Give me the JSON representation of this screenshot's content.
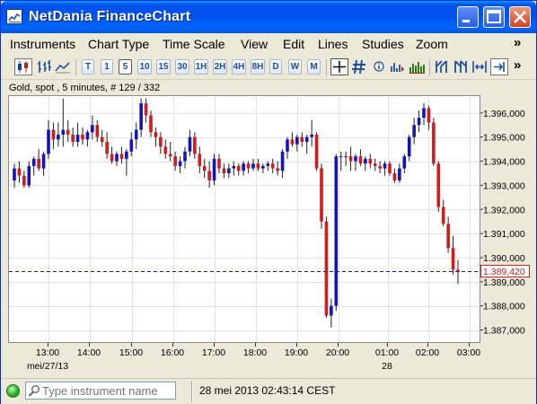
{
  "window": {
    "title": "NetDania FinanceChart"
  },
  "menu": {
    "items": [
      "Instruments",
      "Chart Type",
      "Time Scale",
      "View",
      "Edit",
      "Lines",
      "Studies",
      "Zoom"
    ],
    "more": "»"
  },
  "toolbar": {
    "period_buttons": [
      "T",
      "1",
      "5",
      "10",
      "15",
      "30",
      "1H",
      "2H",
      "4H",
      "8H",
      "D",
      "W",
      "M"
    ],
    "selected_period": "5",
    "more": "»"
  },
  "chart_header": "Gold, spot , 5 minutes, # 129 / 332",
  "statusbar": {
    "search_placeholder": "Type instrument name",
    "datetime": "28 mei 2013 02:43:14 CEST"
  },
  "colors": {
    "up": "#1414b8",
    "down": "#d21c1c",
    "current_line": "#1a237e",
    "titlebar": "#0053ee"
  },
  "chart_data": {
    "type": "candlestick",
    "instrument": "Gold, spot",
    "interval": "5 minutes",
    "ylim": [
      1386.5,
      1396.7
    ],
    "y_ticks": [
      "1.396,000",
      "1.395,000",
      "1.394,000",
      "1.393,000",
      "1.392,000",
      "1.391,000",
      "1.390,000",
      "1.389,000",
      "1.388,000",
      "1.387,000"
    ],
    "y_tick_values": [
      1396,
      1395,
      1394,
      1393,
      1392,
      1391,
      1390,
      1389,
      1388,
      1387
    ],
    "x_ticks": [
      "13:00",
      "14:00",
      "15:00",
      "16:00",
      "17:00",
      "18:00",
      "19:00",
      "20:00",
      "01:00",
      "02:00",
      "03:00"
    ],
    "x_date_labels": [
      {
        "text": "mei/27/13",
        "under": "13:00"
      },
      {
        "text": "28",
        "under": "01:00"
      }
    ],
    "current_price": 1389.42,
    "current_price_label": "1.389,420",
    "candles": [
      [
        1393.2,
        1393.9,
        1392.9,
        1393.7
      ],
      [
        1393.7,
        1394.0,
        1393.1,
        1393.4
      ],
      [
        1393.4,
        1393.6,
        1392.9,
        1393.0
      ],
      [
        1393.0,
        1394.0,
        1392.9,
        1393.8
      ],
      [
        1393.8,
        1394.2,
        1393.4,
        1394.1
      ],
      [
        1394.1,
        1394.5,
        1393.6,
        1393.7
      ],
      [
        1393.7,
        1394.4,
        1393.4,
        1394.3
      ],
      [
        1394.3,
        1395.7,
        1394.1,
        1395.3
      ],
      [
        1395.3,
        1395.6,
        1394.5,
        1394.9
      ],
      [
        1394.9,
        1395.6,
        1394.6,
        1395.1
      ],
      [
        1395.1,
        1396.6,
        1394.6,
        1395.3
      ],
      [
        1395.3,
        1395.7,
        1394.8,
        1395.1
      ],
      [
        1395.1,
        1395.4,
        1394.6,
        1394.8
      ],
      [
        1394.8,
        1395.6,
        1394.6,
        1395.1
      ],
      [
        1395.1,
        1395.4,
        1394.7,
        1394.9
      ],
      [
        1394.9,
        1395.3,
        1394.6,
        1395.2
      ],
      [
        1395.2,
        1395.9,
        1394.9,
        1395.5
      ],
      [
        1395.5,
        1395.7,
        1394.8,
        1395.0
      ],
      [
        1395.0,
        1395.3,
        1394.6,
        1394.8
      ],
      [
        1394.8,
        1395.2,
        1394.1,
        1394.3
      ],
      [
        1394.3,
        1394.6,
        1393.9,
        1394.0
      ],
      [
        1394.0,
        1394.4,
        1393.8,
        1394.3
      ],
      [
        1394.3,
        1394.6,
        1393.9,
        1394.1
      ],
      [
        1394.1,
        1394.5,
        1393.4,
        1394.4
      ],
      [
        1394.4,
        1395.2,
        1394.2,
        1394.9
      ],
      [
        1394.9,
        1395.6,
        1394.5,
        1395.3
      ],
      [
        1395.3,
        1396.6,
        1395.0,
        1396.4
      ],
      [
        1396.4,
        1396.6,
        1395.6,
        1395.9
      ],
      [
        1395.9,
        1396.1,
        1395.0,
        1395.2
      ],
      [
        1395.2,
        1395.4,
        1394.6,
        1395.0
      ],
      [
        1395.0,
        1395.2,
        1394.3,
        1394.6
      ],
      [
        1394.6,
        1394.9,
        1394.1,
        1394.3
      ],
      [
        1394.3,
        1394.8,
        1394.0,
        1394.2
      ],
      [
        1394.2,
        1394.4,
        1393.6,
        1393.8
      ],
      [
        1393.8,
        1394.2,
        1393.5,
        1394.0
      ],
      [
        1394.0,
        1394.6,
        1393.7,
        1394.4
      ],
      [
        1394.4,
        1395.3,
        1394.2,
        1395.0
      ],
      [
        1395.0,
        1395.2,
        1394.1,
        1394.3
      ],
      [
        1394.3,
        1394.6,
        1393.5,
        1393.8
      ],
      [
        1393.8,
        1394.1,
        1393.3,
        1393.6
      ],
      [
        1393.6,
        1394.0,
        1392.9,
        1393.2
      ],
      [
        1393.2,
        1394.3,
        1393.0,
        1394.1
      ],
      [
        1394.1,
        1394.3,
        1393.5,
        1393.7
      ],
      [
        1393.7,
        1393.9,
        1393.3,
        1393.5
      ],
      [
        1393.5,
        1393.9,
        1393.3,
        1393.7
      ],
      [
        1393.7,
        1394.0,
        1393.4,
        1393.8
      ],
      [
        1393.8,
        1393.9,
        1393.4,
        1393.6
      ],
      [
        1393.6,
        1394.0,
        1393.4,
        1393.9
      ],
      [
        1393.9,
        1394.0,
        1393.5,
        1393.7
      ],
      [
        1393.7,
        1394.1,
        1393.6,
        1393.9
      ],
      [
        1393.9,
        1394.1,
        1393.6,
        1393.7
      ],
      [
        1393.7,
        1393.9,
        1393.5,
        1393.8
      ],
      [
        1393.8,
        1394.0,
        1393.6,
        1393.9
      ],
      [
        1393.9,
        1394.1,
        1393.5,
        1393.7
      ],
      [
        1393.7,
        1394.0,
        1393.4,
        1393.6
      ],
      [
        1393.6,
        1394.5,
        1393.3,
        1394.4
      ],
      [
        1394.4,
        1395.0,
        1394.1,
        1394.9
      ],
      [
        1394.9,
        1395.2,
        1394.6,
        1394.7
      ],
      [
        1394.7,
        1395.1,
        1394.4,
        1395.0
      ],
      [
        1395.0,
        1395.2,
        1394.6,
        1394.8
      ],
      [
        1394.8,
        1395.1,
        1394.3,
        1395.0
      ],
      [
        1395.0,
        1395.7,
        1394.6,
        1395.1
      ],
      [
        1395.1,
        1395.2,
        1393.6,
        1393.7
      ],
      [
        1393.7,
        1393.9,
        1391.2,
        1391.5
      ],
      [
        1391.5,
        1391.7,
        1387.5,
        1387.6
      ],
      [
        1387.6,
        1388.3,
        1387.1,
        1388.0
      ],
      [
        1388.0,
        1394.3,
        1387.8,
        1394.2
      ],
      [
        1394.2,
        1394.4,
        1393.6,
        1394.2
      ],
      [
        1394.2,
        1394.4,
        1393.8,
        1394.2
      ],
      [
        1394.2,
        1394.6,
        1393.6,
        1394.0
      ],
      [
        1394.0,
        1394.3,
        1393.6,
        1394.2
      ],
      [
        1394.2,
        1394.5,
        1393.8,
        1393.9
      ],
      [
        1393.9,
        1394.2,
        1393.6,
        1394.1
      ],
      [
        1394.1,
        1394.3,
        1393.7,
        1393.9
      ],
      [
        1393.9,
        1394.1,
        1393.6,
        1393.8
      ],
      [
        1393.8,
        1394.0,
        1393.5,
        1393.7
      ],
      [
        1393.7,
        1394.0,
        1393.4,
        1393.9
      ],
      [
        1393.9,
        1394.0,
        1393.4,
        1393.5
      ],
      [
        1393.5,
        1393.7,
        1393.1,
        1393.2
      ],
      [
        1393.2,
        1393.9,
        1393.1,
        1393.7
      ],
      [
        1393.7,
        1394.3,
        1393.5,
        1394.2
      ],
      [
        1394.2,
        1395.1,
        1394.0,
        1395.0
      ],
      [
        1395.0,
        1395.8,
        1394.7,
        1395.5
      ],
      [
        1395.5,
        1396.1,
        1395.2,
        1395.8
      ],
      [
        1395.8,
        1396.4,
        1395.5,
        1396.2
      ],
      [
        1396.2,
        1396.3,
        1395.3,
        1395.6
      ],
      [
        1395.6,
        1395.8,
        1393.8,
        1393.9
      ],
      [
        1393.9,
        1394.0,
        1391.9,
        1392.1
      ],
      [
        1392.1,
        1392.4,
        1391.3,
        1391.4
      ],
      [
        1391.4,
        1391.7,
        1390.2,
        1390.4
      ],
      [
        1390.4,
        1390.9,
        1389.3,
        1389.5
      ],
      [
        1389.5,
        1389.9,
        1388.9,
        1389.4
      ]
    ]
  }
}
